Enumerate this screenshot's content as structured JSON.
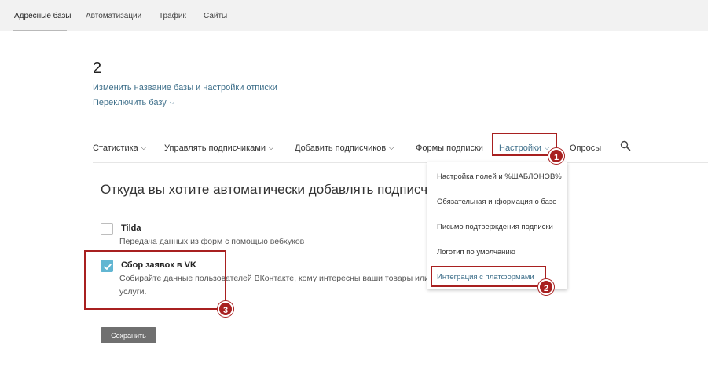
{
  "topnav": {
    "tabs": [
      {
        "label": "Адресные базы",
        "active": true
      },
      {
        "label": "Автоматизации",
        "active": false
      },
      {
        "label": "Трафик",
        "active": false
      },
      {
        "label": "Сайты",
        "active": false
      }
    ]
  },
  "database": {
    "title": "2",
    "rename_link": "Изменить название базы и настройки отписки",
    "switch_link": "Переключить базу"
  },
  "subnav": {
    "items": [
      {
        "label": "Статистика",
        "has_dropdown": true
      },
      {
        "label": "Управлять подписчиками",
        "has_dropdown": true
      },
      {
        "label": "Добавить подписчиков",
        "has_dropdown": true
      },
      {
        "label": "Формы подписки",
        "has_dropdown": false
      },
      {
        "label": "Настройки",
        "has_dropdown": true,
        "active": true
      },
      {
        "label": "Опросы",
        "has_dropdown": false
      }
    ],
    "search_icon": "search-icon"
  },
  "settings_dropdown": {
    "items": [
      {
        "label": "Настройка полей и %ШАБЛОНОВ%"
      },
      {
        "label": "Обязательная информация о базе"
      },
      {
        "label": "Письмо подтверждения подписки"
      },
      {
        "label": "Логотип по умолчанию"
      },
      {
        "label": "Интеграция с платформами",
        "active": true
      }
    ]
  },
  "main": {
    "title": "Откуда вы хотите автоматически добавлять подписчиков?",
    "options": [
      {
        "title": "Tilda",
        "description": "Передача данных из форм с помощью вебхуков",
        "checked": false
      },
      {
        "title": "Сбор заявок в VK",
        "description": "Собирайте данные пользователей ВКонтакте, кому интересны ваши товары или услуги.",
        "description_line1": "Собирайте данные пользователей ВКонтакте, кому интересны ваши товары или",
        "description_line2": "услуги.",
        "checked": true
      }
    ],
    "save_label": "Сохранить"
  },
  "annotations": {
    "badges": [
      "1",
      "2",
      "3"
    ],
    "color": "#a82020"
  },
  "colors": {
    "link": "#3e6f8a",
    "checkbox_checked": "#62b6d2",
    "button": "#707070",
    "topbar": "#f2f2f2"
  }
}
